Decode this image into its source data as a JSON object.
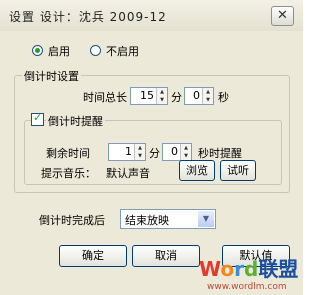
{
  "window": {
    "title": "设置   设计：沈兵  2009-12",
    "close_glyph": "✕"
  },
  "mode": {
    "enable_label": "启用",
    "disable_label": "不启用",
    "selected": "enable"
  },
  "countdown_settings": {
    "group_label": "倒计时设置",
    "total_time_label": "时间总长",
    "minutes_value": "15",
    "minutes_unit": "分",
    "seconds_value": "0",
    "seconds_unit": "秒"
  },
  "reminder": {
    "checkbox_label": "倒计时提醒",
    "checked": true,
    "remaining_label": "剩余时间",
    "minutes_value": "1",
    "minutes_unit": "分",
    "seconds_value": "0",
    "seconds_suffix": "秒时提醒",
    "music_label": "提示音乐：",
    "music_value": "默认声音",
    "browse_label": "浏览",
    "preview_label": "试听"
  },
  "after_finish": {
    "label": "倒计时完成后",
    "selected": "结束放映"
  },
  "buttons": {
    "ok_label": "确定",
    "cancel_label": "取消",
    "default_label": "默认值"
  },
  "watermark": {
    "text_main": "Word联盟",
    "text_url": "www.wordlm.com",
    "colors": [
      "#e23b2e",
      "#f08a1c",
      "#3a8fd6",
      "#5bb033",
      "#1d4fa0"
    ]
  },
  "colors": {
    "dialog_bg": "#ece9d8",
    "accent_green": "#21a121",
    "border_blue": "#7f9db9",
    "button_border": "#003c74"
  }
}
